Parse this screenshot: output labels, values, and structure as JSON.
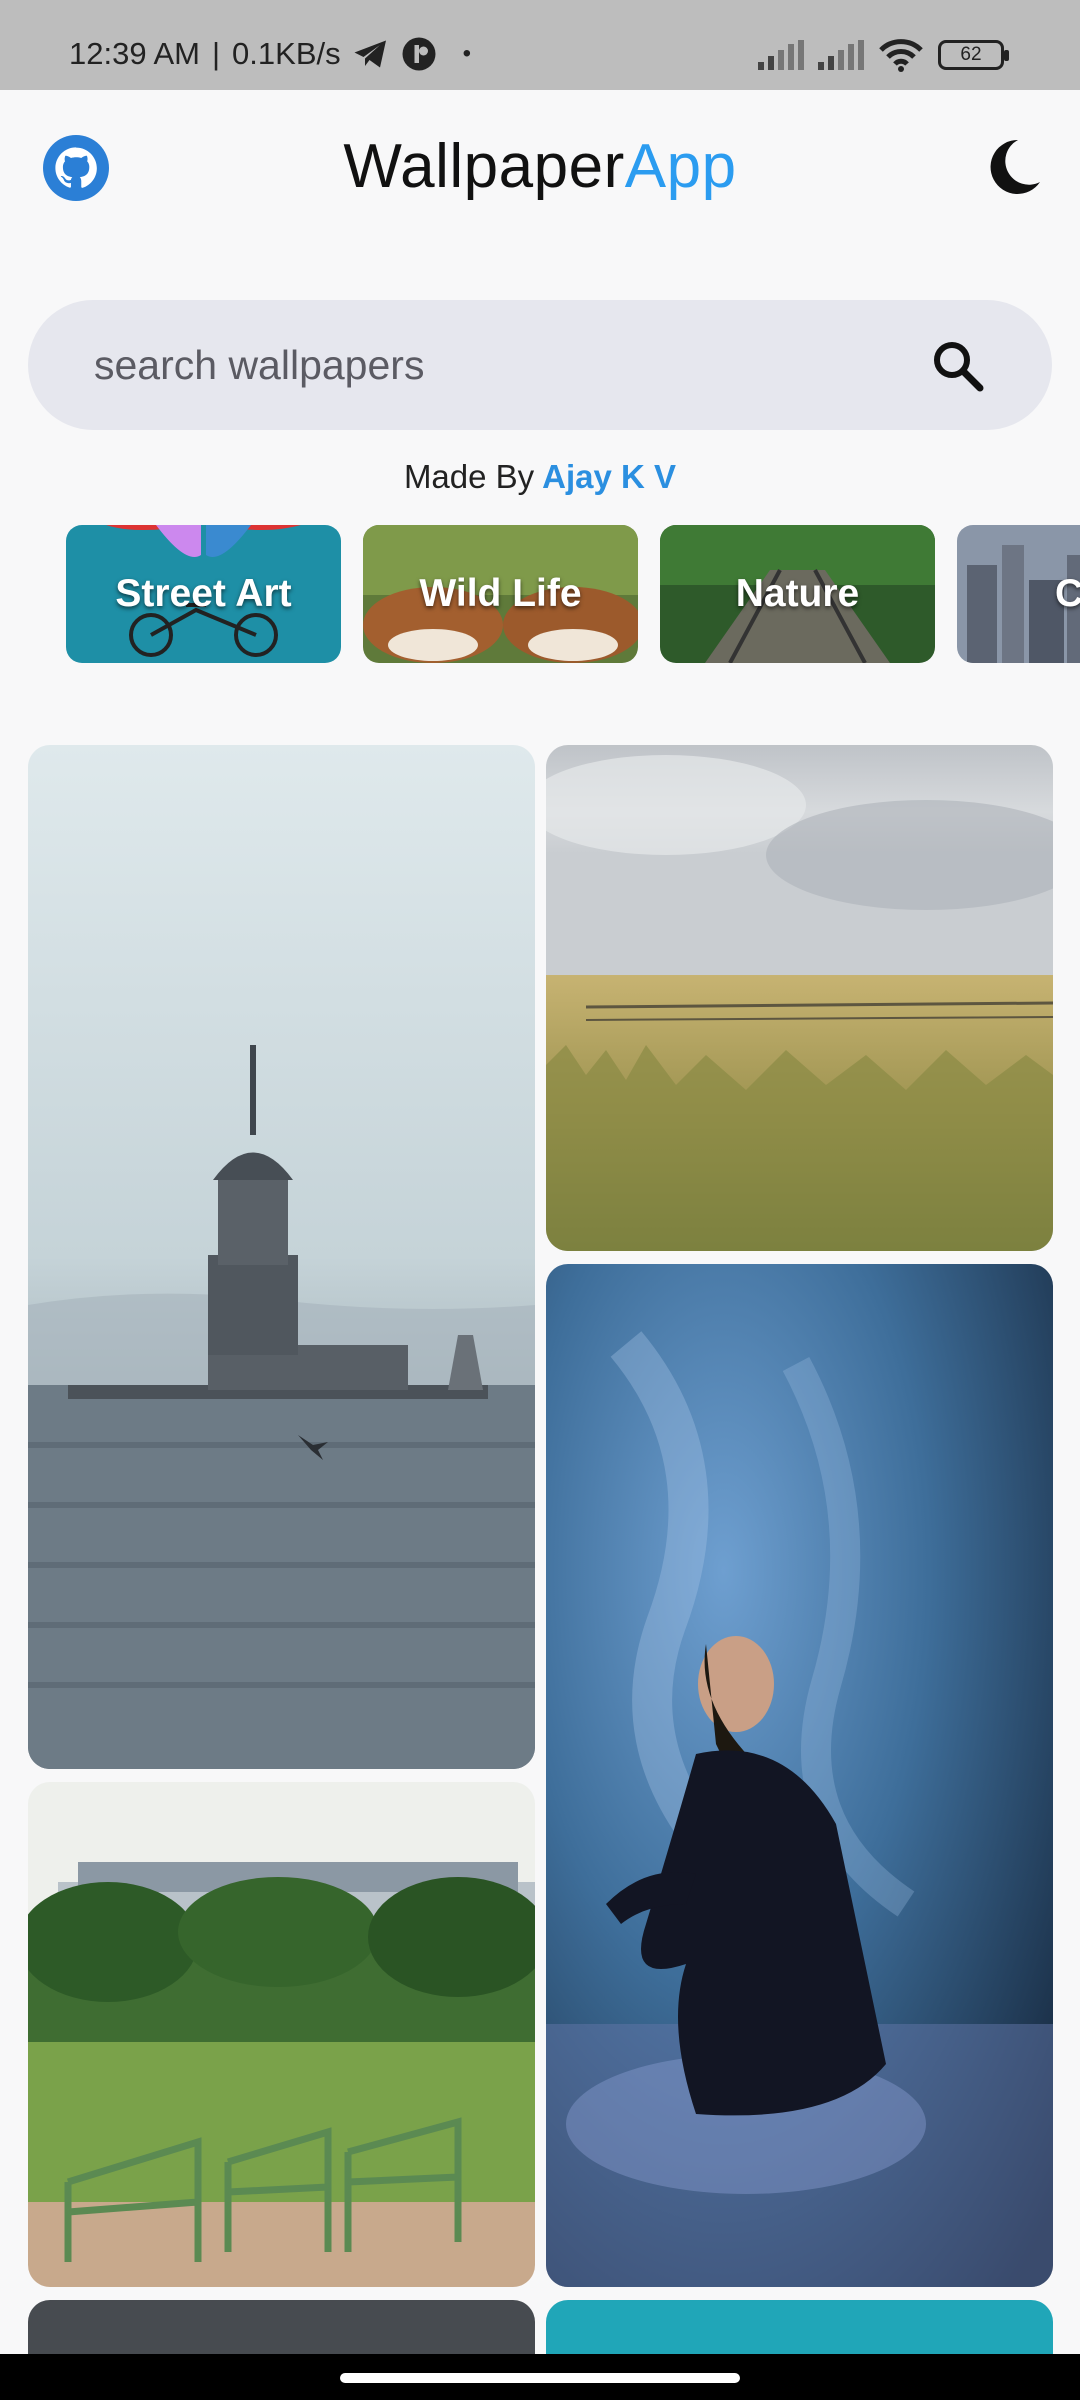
{
  "status_bar": {
    "time": "12:39 AM",
    "speed": "0.1KB/s",
    "battery": "62"
  },
  "header": {
    "title_part1": "Wallpaper",
    "title_part2": "App"
  },
  "search": {
    "placeholder": "search wallpapers"
  },
  "credit": {
    "prefix": "Made By",
    "author": "Ajay K V"
  },
  "categories": [
    {
      "label": "Street Art"
    },
    {
      "label": "Wild Life"
    },
    {
      "label": "Nature"
    },
    {
      "label": "C"
    }
  ],
  "wallpapers": [
    {
      "subject": "lighthouse tower in the sea"
    },
    {
      "subject": "grass field under cloudy sky"
    },
    {
      "subject": "woman in blue studio light"
    },
    {
      "subject": "park with green chairs"
    }
  ],
  "colors": {
    "accent": "#2b9cf0",
    "search_bg": "#e6e7ee"
  }
}
